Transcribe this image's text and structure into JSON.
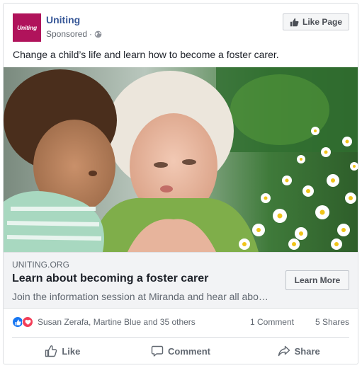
{
  "header": {
    "avatar_text": "Uniting",
    "page_name": "Uniting",
    "sponsored": "Sponsored",
    "dot": "·",
    "like_page_label": "Like Page"
  },
  "post": {
    "text": "Change a child’s life and learn how to become a foster carer."
  },
  "link": {
    "domain": "UNITING.ORG",
    "title": "Learn about becoming a foster carer",
    "description": "Join the information session at Miranda and hear all abo…",
    "cta_label": "Learn More"
  },
  "reactions": {
    "names": "Susan Zerafa, Martine Blue and 35 others",
    "comments": "1 Comment",
    "shares": "5 Shares"
  },
  "actions": {
    "like": "Like",
    "comment": "Comment",
    "share": "Share"
  },
  "colors": {
    "brand": "#b0135b",
    "link_name": "#385898",
    "like_blue": "#1877f2",
    "love_red": "#f33e58"
  },
  "icons": [
    "globe-icon",
    "thumbs-up-icon",
    "comment-icon",
    "share-icon",
    "like-reaction-icon",
    "love-reaction-icon"
  ]
}
